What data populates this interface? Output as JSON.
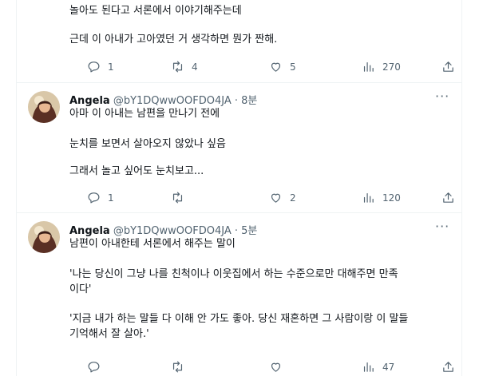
{
  "tweets": [
    {
      "lines": [
        "놀아도 된다고 서론에서 이야기해주는데",
        "근데 이 아내가 고아였던 거 생각하면 뭔가 짠해."
      ],
      "actions": {
        "reply": "1",
        "retweet": "4",
        "like": "5",
        "views": "270"
      }
    },
    {
      "name": "Angela",
      "handle": "@bY1DQwwOOFDO4JA",
      "time": "· 8분",
      "lines": [
        "아마 이 아내는 남편을 만나기 전에",
        "눈치를 보면서 살아오지 않았나 싶음",
        "그래서 놀고 싶어도 눈치보고..."
      ],
      "actions": {
        "reply": "1",
        "retweet": "",
        "like": "2",
        "views": "120"
      }
    },
    {
      "name": "Angela",
      "handle": "@bY1DQwwOOFDO4JA",
      "time": "· 5분",
      "lines": [
        "남편이 아내한테 서론에서 해주는 말이",
        "'나는 당신이 그냥 나를 친척이나 이웃집에서 하는 수준으로만 대해주면 만족",
        "이다'",
        "'지금 내가 하는 말들 다 이해 안 가도 좋아. 당신 재혼하면 그 사람이랑 이 말들",
        "기억해서 잘 살아.'"
      ],
      "actions": {
        "reply": "",
        "retweet": "",
        "like": "",
        "views": "47"
      }
    }
  ],
  "more_label": "···",
  "icons": [
    "reply-icon",
    "retweet-icon",
    "like-icon",
    "views-icon",
    "share-icon",
    "more-icon"
  ]
}
